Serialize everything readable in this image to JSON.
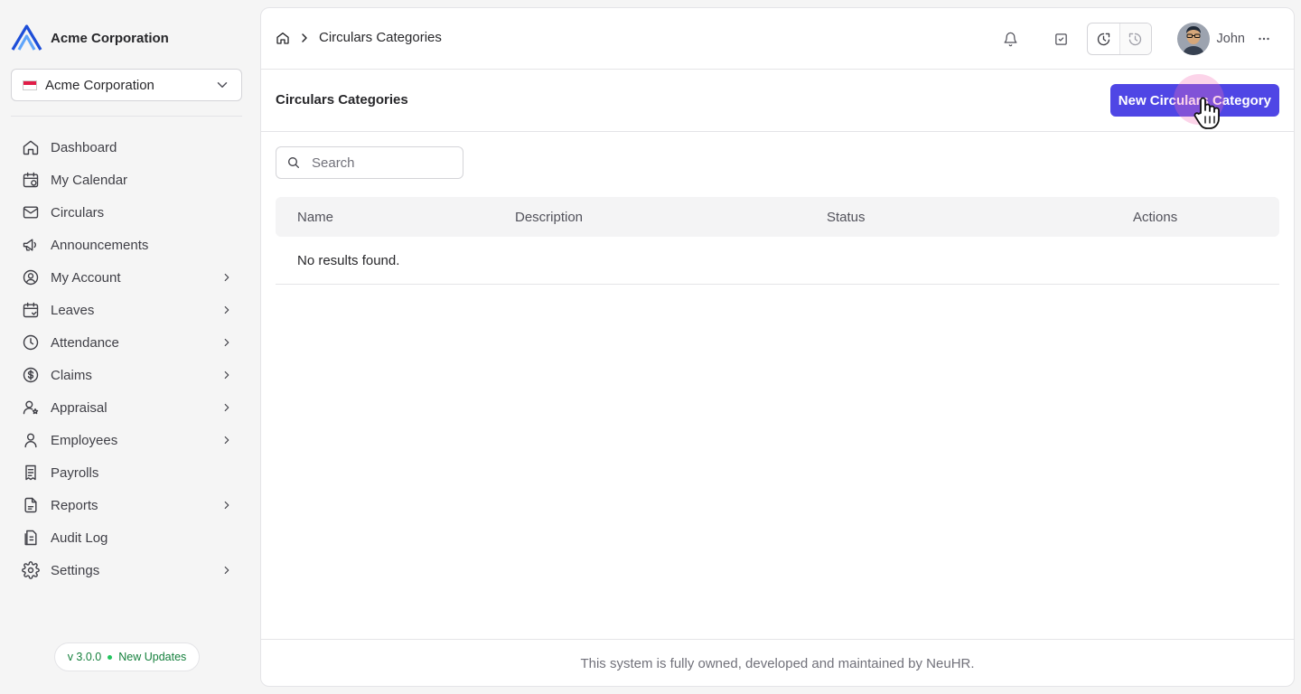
{
  "brand": {
    "name": "Acme Corporation",
    "logo_icon": "acme-logo-icon"
  },
  "org_selector": {
    "value": "Acme Corporation",
    "flag_icon": "flag-icon"
  },
  "sidebar": {
    "items": [
      {
        "label": "Dashboard",
        "icon": "home-icon",
        "has_children": false
      },
      {
        "label": "My Calendar",
        "icon": "calendar-icon",
        "has_children": false
      },
      {
        "label": "Circulars",
        "icon": "mail-icon",
        "has_children": false
      },
      {
        "label": "Announcements",
        "icon": "megaphone-icon",
        "has_children": false
      },
      {
        "label": "My Account",
        "icon": "user-circle-icon",
        "has_children": true
      },
      {
        "label": "Leaves",
        "icon": "calendar-check-icon",
        "has_children": true
      },
      {
        "label": "Attendance",
        "icon": "clock-icon",
        "has_children": true
      },
      {
        "label": "Claims",
        "icon": "dollar-circle-icon",
        "has_children": true
      },
      {
        "label": "Appraisal",
        "icon": "user-star-icon",
        "has_children": true
      },
      {
        "label": "Employees",
        "icon": "user-icon",
        "has_children": true
      },
      {
        "label": "Payrolls",
        "icon": "receipt-icon",
        "has_children": false
      },
      {
        "label": "Reports",
        "icon": "document-icon",
        "has_children": true
      },
      {
        "label": "Audit Log",
        "icon": "clipboard-icon",
        "has_children": false
      },
      {
        "label": "Settings",
        "icon": "gear-icon",
        "has_children": true
      }
    ],
    "version": "v 3.0.0",
    "updates_label": "New Updates"
  },
  "header": {
    "breadcrumb": {
      "current": "Circulars Categories"
    },
    "user": {
      "name": "John"
    }
  },
  "page": {
    "title": "Circulars Categories",
    "new_button_label": "New Circulars Category"
  },
  "search": {
    "placeholder": "Search",
    "value": ""
  },
  "table": {
    "columns": [
      "Name",
      "Description",
      "Status",
      "Actions"
    ],
    "rows": [],
    "empty_text": "No results found."
  },
  "footer": {
    "text": "This system is fully owned, developed and maintained by NeuHR."
  },
  "colors": {
    "primary": "#4f46e5",
    "status_green": "#22c55e"
  }
}
